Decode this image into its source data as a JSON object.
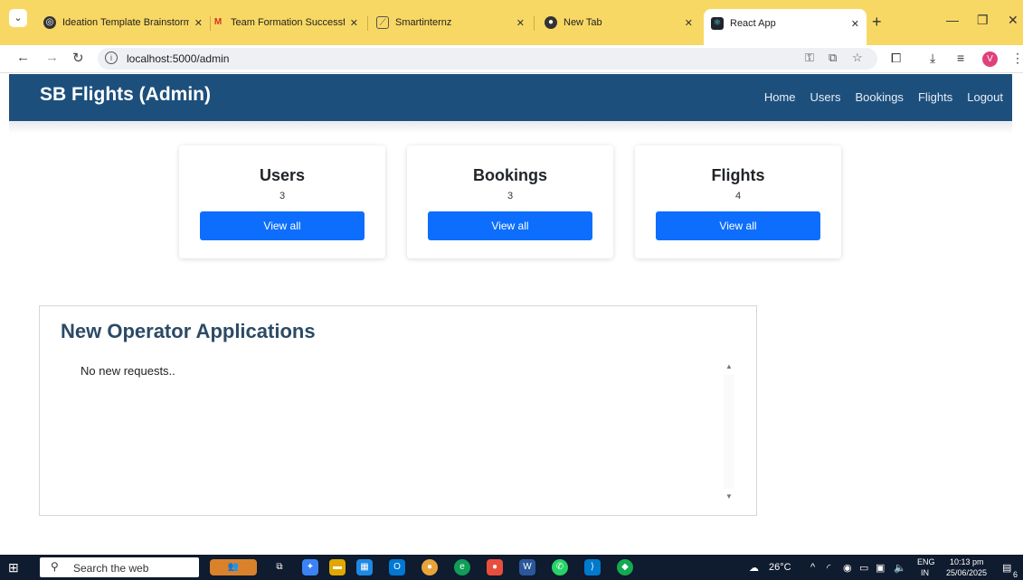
{
  "browser": {
    "tabs": [
      {
        "title": "Ideation Template Brainstorm",
        "icon": "target-icon"
      },
      {
        "title": "Team Formation Successful",
        "icon": "gmail-icon"
      },
      {
        "title": "Smartinternz",
        "icon": "smartinternz-icon"
      },
      {
        "title": "New Tab",
        "icon": "chrome-icon"
      },
      {
        "title": "React App",
        "icon": "react-icon"
      }
    ],
    "url": "localhost:5000/admin",
    "profile_initial": "V"
  },
  "app": {
    "brand": "SB Flights (Admin)",
    "nav": [
      "Home",
      "Users",
      "Bookings",
      "Flights",
      "Logout"
    ],
    "cards": [
      {
        "title": "Users",
        "count": "3",
        "button": "View all"
      },
      {
        "title": "Bookings",
        "count": "3",
        "button": "View all"
      },
      {
        "title": "Flights",
        "count": "4",
        "button": "View all"
      }
    ],
    "applications": {
      "title": "New Operator Applications",
      "empty_message": "No new requests.."
    }
  },
  "taskbar": {
    "search_placeholder": "Search the web",
    "weather": "26°C",
    "lang_line1": "ENG",
    "lang_line2": "IN",
    "time": "10:13 pm",
    "date": "25/06/2025",
    "notification_count": "6"
  }
}
